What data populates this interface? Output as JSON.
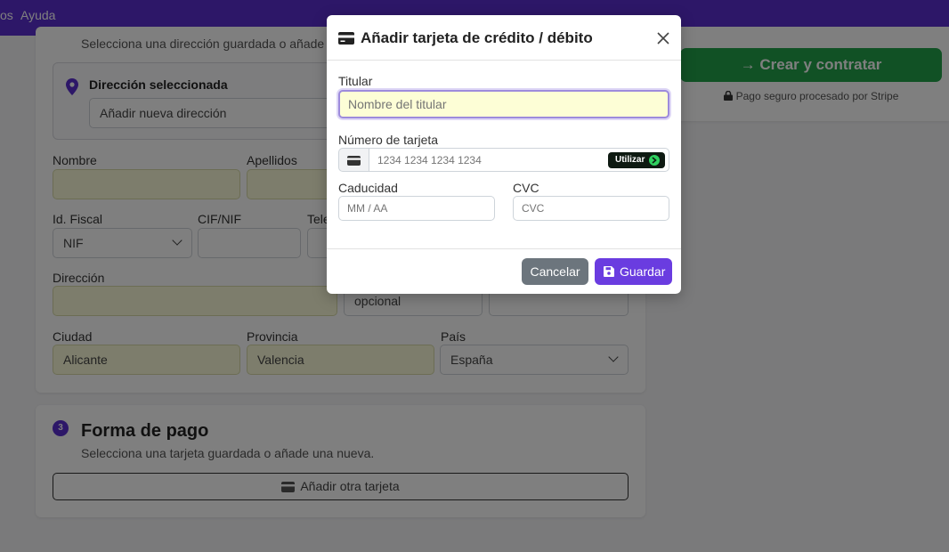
{
  "topbar": {
    "nav_partial": "os",
    "help": "Ayuda"
  },
  "address_section": {
    "subtitle": "Selecciona una dirección guardada o añade u",
    "selected_label": "Dirección seleccionada",
    "selected_value": "Añadir nueva dirección",
    "fields": {
      "nombre_label": "Nombre",
      "apellidos_label": "Apellidos",
      "idfiscal_label": "Id. Fiscal",
      "idfiscal_value": "NIF",
      "cifnif_label": "CIF/NIF",
      "telefono_label": "Tele",
      "direccion_label": "Dirección",
      "opcional_placeholder": "opcional",
      "ciudad_label": "Ciudad",
      "ciudad_value": "Alicante",
      "provincia_label": "Provincia",
      "provincia_value": "Valencia",
      "pais_label": "País",
      "pais_value": "España"
    }
  },
  "payment_section": {
    "step": "3",
    "title": "Forma de pago",
    "subtitle": "Selecciona una tarjeta guardada o añade una nueva.",
    "add_card_button": "Añadir otra tarjeta"
  },
  "sidebar": {
    "create_button": "Crear y contratar",
    "secure_note": "Pago seguro procesado por Stripe"
  },
  "modal": {
    "title": "Añadir tarjeta de crédito / débito",
    "titular_label": "Titular",
    "titular_placeholder": "Nombre del titular",
    "card_number_label": "Número de tarjeta",
    "card_number_placeholder": "1234 1234 1234 1234",
    "use_button": "Utilizar",
    "expiry_label": "Caducidad",
    "expiry_placeholder": "MM / AA",
    "cvc_label": "CVC",
    "cvc_placeholder": "CVC",
    "cancel_button": "Cancelar",
    "save_button": "Guardar"
  },
  "colors": {
    "brand": "#5b2fd1",
    "create_green": "#22a34a",
    "save_purple": "#6a3ce0",
    "cancel_gray": "#6c757d",
    "filled_field": "#fafbd8"
  }
}
